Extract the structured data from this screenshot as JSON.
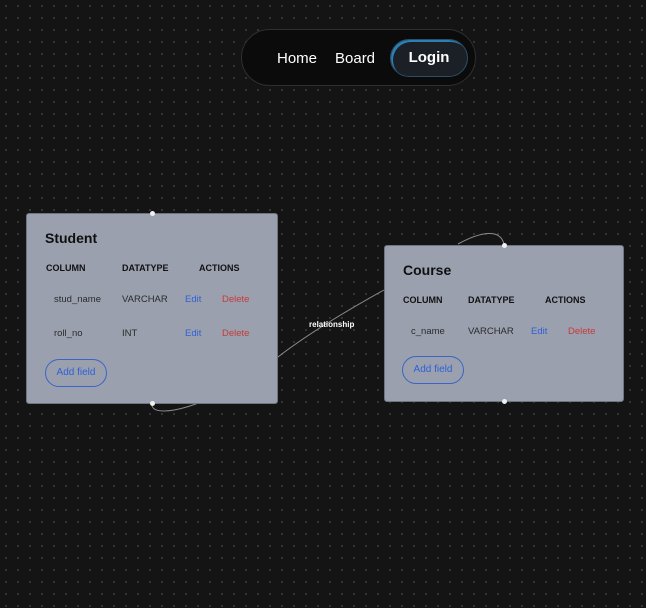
{
  "nav": {
    "home": "Home",
    "board": "Board",
    "login": "Login"
  },
  "edge": {
    "label": "relationship"
  },
  "tables": {
    "student": {
      "title": "Student",
      "headers": {
        "column": "COLUMN",
        "datatype": "DATATYPE",
        "actions": "ACTIONS"
      },
      "rows": [
        {
          "name": "stud_name",
          "type": "VARCHAR",
          "edit": "Edit",
          "delete": "Delete"
        },
        {
          "name": "roll_no",
          "type": "INT",
          "edit": "Edit",
          "delete": "Delete"
        }
      ],
      "add_label": "Add field"
    },
    "course": {
      "title": "Course",
      "headers": {
        "column": "COLUMN",
        "datatype": "DATATYPE",
        "actions": "ACTIONS"
      },
      "rows": [
        {
          "name": "c_name",
          "type": "VARCHAR",
          "edit": "Edit",
          "delete": "Delete"
        }
      ],
      "add_label": "Add field"
    }
  }
}
